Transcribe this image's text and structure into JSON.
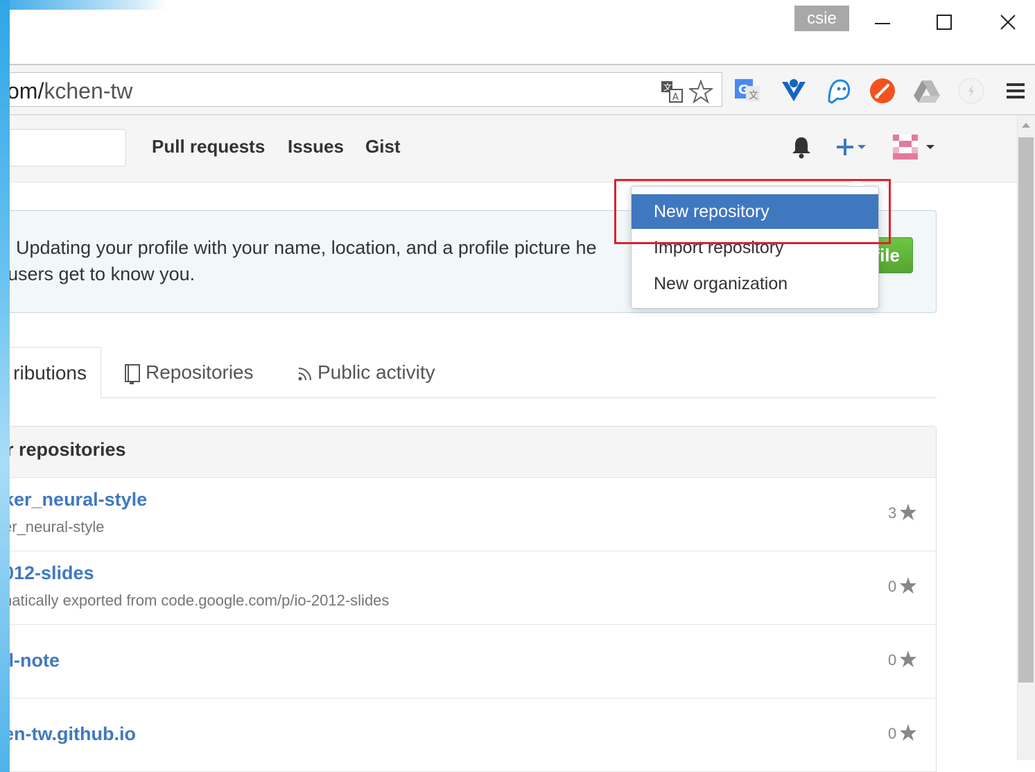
{
  "window": {
    "profile_badge": "csie"
  },
  "address_bar": {
    "url_domain": "om/",
    "url_path": "kchen-tw"
  },
  "header_nav": {
    "links": [
      "Pull requests",
      "Issues",
      "Gist"
    ]
  },
  "notice": {
    "text": "Updating your profile with your name, location, and a profile picture he",
    "text_line2": "users get to know you.",
    "button_label": "file"
  },
  "new_menu": {
    "items": [
      "New repository",
      "Import repository",
      "New organization"
    ],
    "active_index": 0
  },
  "tabs": {
    "items": [
      "ributions",
      "Repositories",
      "Public activity"
    ],
    "selected_index": 0
  },
  "repositories": {
    "title": "r repositories",
    "items": [
      {
        "name": "ker_neural-style",
        "description": "er_neural-style",
        "stars": "3"
      },
      {
        "name": "012-slides",
        "description": "natically exported from code.google.com/p/io-2012-slides",
        "stars": "0"
      },
      {
        "name": "ll-note",
        "description": "",
        "stars": "0"
      },
      {
        "name": "en-tw.github.io",
        "description": "",
        "stars": "0"
      }
    ]
  },
  "colors": {
    "link_blue": "#4078c0",
    "highlight_red": "#e0202c",
    "green_button": "#55a532"
  }
}
